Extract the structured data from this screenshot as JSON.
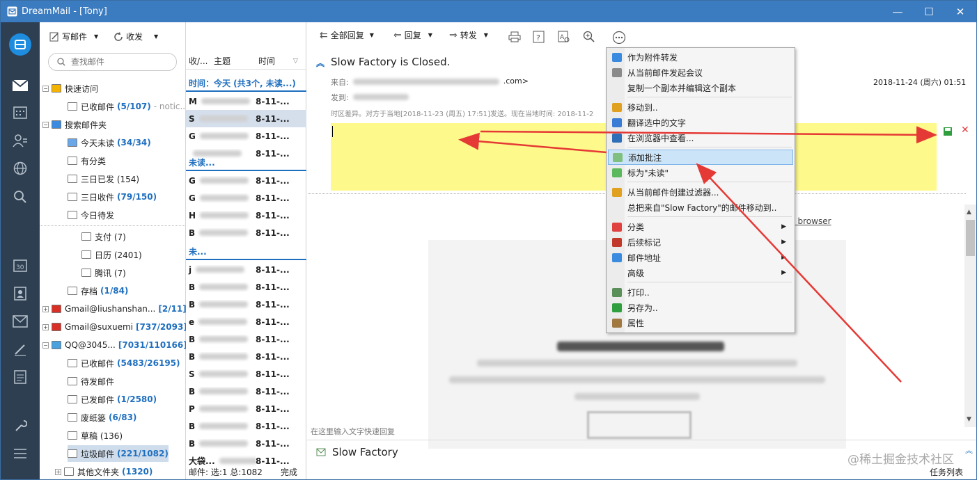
{
  "window": {
    "title": "DreamMail - [Tony]",
    "minimize": "—",
    "maximize": "☐",
    "close": "✕"
  },
  "rail": {
    "items": [
      "mail-logo-icon",
      "inbox-icon",
      "calendar-grid-icon",
      "contacts-icon",
      "globe-icon",
      "search-icon",
      "calendar-30-icon",
      "contact-card-icon",
      "envelope-icon",
      "pen-icon",
      "notes-icon",
      "wrench-icon",
      "menu-icon"
    ]
  },
  "folder_toolbar": {
    "compose": "写邮件",
    "receive": "收发"
  },
  "search": {
    "placeholder": "查找邮件"
  },
  "folders": [
    {
      "label": "快速访问",
      "count": "",
      "expander": "−"
    },
    {
      "label": "已收邮件",
      "count": "(5/107)",
      "extra": "- notic..."
    },
    {
      "label": "搜索邮件夹",
      "count": "",
      "expander": "−"
    },
    {
      "label": "今天未读",
      "count": "(34/34)"
    },
    {
      "label": "有分类",
      "count": ""
    },
    {
      "label": "三日已发 (154)",
      "count": ""
    },
    {
      "label": "三日收件",
      "count": "(79/150)"
    },
    {
      "label": "今日待发",
      "count": ""
    },
    {
      "label": "支付 (7)",
      "count": ""
    },
    {
      "label": "日历 (2401)",
      "count": ""
    },
    {
      "label": "腾讯 (7)",
      "count": ""
    },
    {
      "label": "存档",
      "count": "(1/84)"
    },
    {
      "label": "Gmail@liushanshan...",
      "count": "[2/11]",
      "expander": "+"
    },
    {
      "label": "Gmail@suxuemi",
      "count": "[737/2093]",
      "expander": "+"
    },
    {
      "label": "QQ@3045...",
      "count": "[7031/110166]",
      "expander": "−"
    },
    {
      "label": "已收邮件",
      "count": "(5483/26195)"
    },
    {
      "label": "待发邮件",
      "count": ""
    },
    {
      "label": "已发邮件",
      "count": "(1/2580)"
    },
    {
      "label": "废纸篓",
      "count": "(6/83)"
    },
    {
      "label": "草稿 (136)",
      "count": ""
    },
    {
      "label": "垃圾邮件",
      "count": "(221/1082)"
    },
    {
      "label": "其他文件夹",
      "count": "(1320)",
      "expander": "+"
    }
  ],
  "list": {
    "columns": [
      "收/...",
      "主题",
      "时间"
    ],
    "group1": "时间：今天 (共3个, 未读...)",
    "group2": "未读...",
    "group3": "未...",
    "date_cell": "8-11-...",
    "row_initials": [
      "M",
      "S",
      "G",
      "",
      "b",
      "G",
      "G",
      "H",
      "B",
      "",
      "j",
      "B",
      "B",
      "e",
      "B",
      "B",
      "S",
      "B",
      "P",
      "B",
      "B",
      "",
      "",
      "大袋..."
    ],
    "status": "邮件: 选:1 总:1082",
    "status_done": "完成"
  },
  "reader_toolbar": {
    "reply_all": "全部回复",
    "reply": "回复",
    "forward": "转发"
  },
  "email": {
    "subject": "Slow Factory is Closed.",
    "from_label": "来自:",
    "from_tail": ".com>",
    "to_label": "发到:",
    "date": "2018-11-24 (周六) 01:51",
    "tz_note": "时区差异。对方于当地[2018-11-23 (周五) 17:51]发送。现在当地时间: 2018-11-2",
    "browser_link": "t browser",
    "quick_reply": "在这里输入文字快速回复",
    "preview_subject": "Slow Factory"
  },
  "context_menu": [
    {
      "label": "作为附件转发",
      "icon": "forward-attachment-icon",
      "color": "#3a8be0"
    },
    {
      "label": "从当前邮件发起会议",
      "icon": "meeting-icon",
      "color": "#8a8a8a"
    },
    {
      "label": "复制一个副本并编辑这个副本",
      "icon": "",
      "color": ""
    },
    {
      "label": "移动到..",
      "icon": "move-icon",
      "color": "#e0a020",
      "sep_before": true
    },
    {
      "label": "翻译选中的文字",
      "icon": "translate-icon",
      "color": "#3a7bd5"
    },
    {
      "label": "在浏览器中查看...",
      "icon": "browser-icon",
      "color": "#2f6fb7"
    },
    {
      "label": "添加批注",
      "icon": "annotation-icon",
      "color": "#7fbf7f",
      "sep_before": true,
      "highlight": true
    },
    {
      "label": "标为\"未读\"",
      "icon": "mark-unread-icon",
      "color": "#5cb85c"
    },
    {
      "label": "从当前邮件创建过滤器...",
      "icon": "filter-icon",
      "color": "#e0a020",
      "sep_before": true
    },
    {
      "label": "总把来自\"Slow Factory\"的邮件移动到..",
      "icon": "",
      "color": ""
    },
    {
      "label": "分类",
      "icon": "category-icon",
      "color": "#e04040",
      "sep_before": true,
      "submenu": true
    },
    {
      "label": "后续标记",
      "icon": "flag-icon",
      "color": "#c0392b",
      "submenu": true
    },
    {
      "label": "邮件地址",
      "icon": "address-icon",
      "color": "#3a8be0",
      "submenu": true
    },
    {
      "label": "高级",
      "icon": "",
      "color": "",
      "submenu": true
    },
    {
      "label": "打印..",
      "icon": "print-icon",
      "color": "#5a8f5a",
      "sep_before": true
    },
    {
      "label": "另存为..",
      "icon": "save-icon",
      "color": "#2e9e3e"
    },
    {
      "label": "属性",
      "icon": "properties-icon",
      "color": "#a07840"
    }
  ],
  "watermark": "@稀土掘金技术社区",
  "task_list": "任务列表"
}
